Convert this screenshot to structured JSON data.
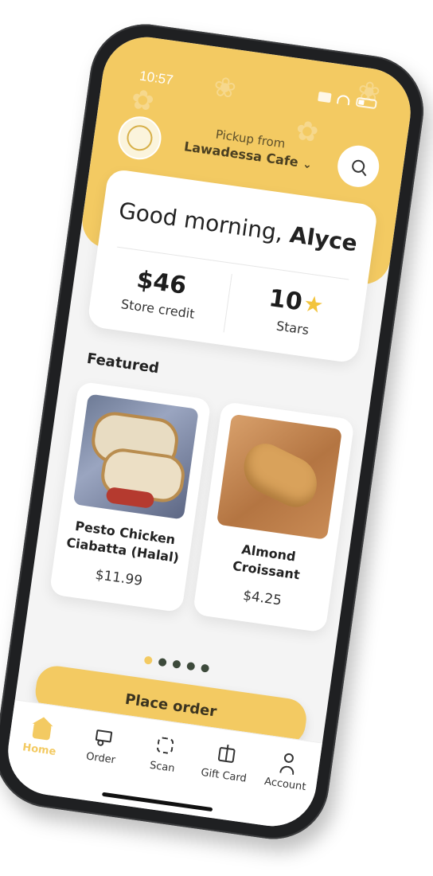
{
  "status": {
    "time": "10:57"
  },
  "header": {
    "pickup_label": "Pickup from",
    "store_name": "Lawadessa Cafe",
    "logo_name": "Lawadessa Cafe"
  },
  "greeting": {
    "prefix": "Good morning,",
    "name": "Alyce"
  },
  "stats": {
    "credit_value": "$46",
    "credit_label": "Store credit",
    "stars_value": "10",
    "stars_label": "Stars"
  },
  "featured": {
    "title": "Featured",
    "items": [
      {
        "name": "Pesto Chicken Ciabatta (Halal)",
        "price": "$11.99"
      },
      {
        "name": "Almond Croissant",
        "price": "$4.25"
      }
    ]
  },
  "carousel": {
    "count": 5,
    "active_index": 0
  },
  "primary_action": {
    "label": "Place order"
  },
  "tabbar": {
    "items": [
      {
        "label": "Home",
        "icon": "home-icon",
        "active": true
      },
      {
        "label": "Order",
        "icon": "cart-icon",
        "active": false
      },
      {
        "label": "Scan",
        "icon": "scan-icon",
        "active": false
      },
      {
        "label": "Gift Card",
        "icon": "gift-icon",
        "active": false
      },
      {
        "label": "Account",
        "icon": "account-icon",
        "active": false
      }
    ]
  },
  "colors": {
    "accent": "#f3ca62",
    "bezel": "#1f2022"
  }
}
